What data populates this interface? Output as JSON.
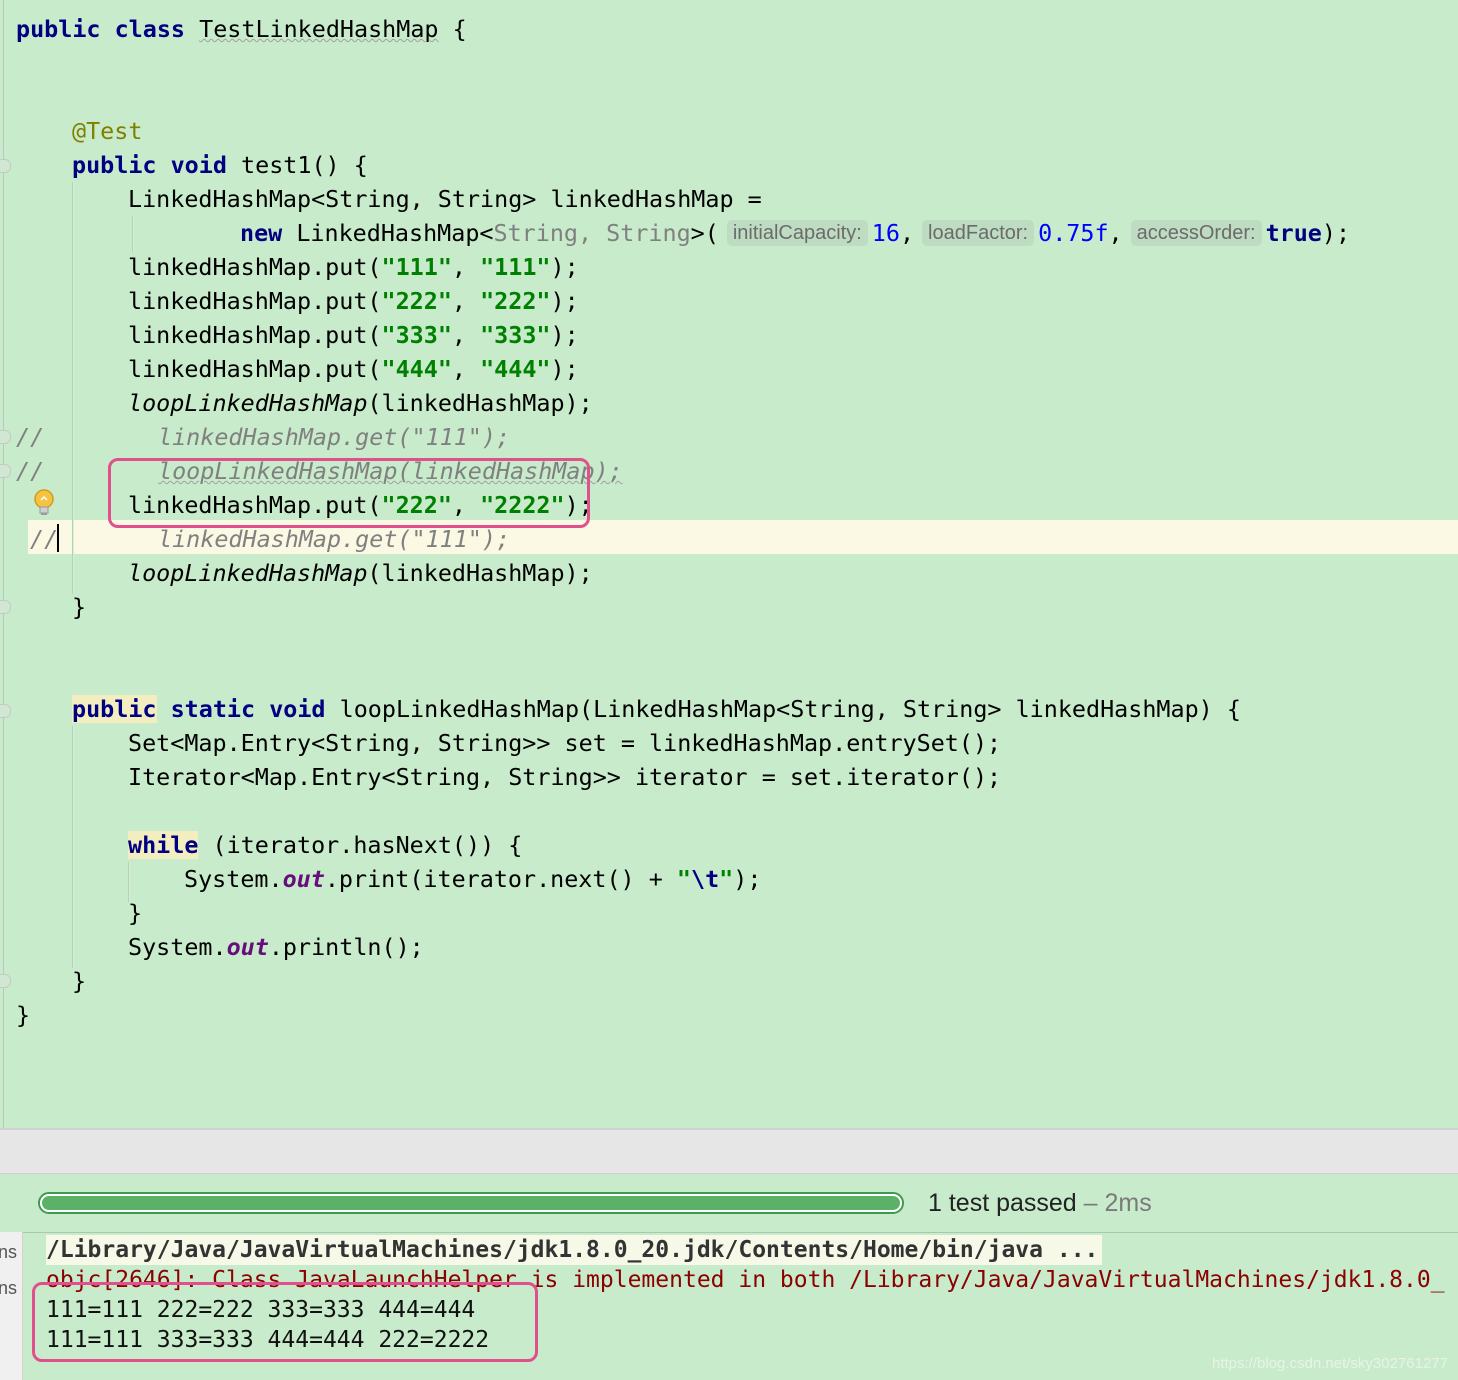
{
  "editor": {
    "class_decl": {
      "kw1": "public",
      "kw2": "class",
      "name": "TestLinkedHashMap",
      "brace": "{"
    },
    "annotation": "@Test",
    "test_method": {
      "kw1": "public",
      "kw2": "void",
      "sig": "test1() {"
    },
    "decl_line": "LinkedHashMap<String, String> linkedHashMap =",
    "ctor_line": {
      "kw": "new",
      "type": "LinkedHashMap<",
      "generics": "String, String",
      "open": ">(",
      "hint1": "initialCapacity:",
      "arg1": "16",
      "comma1": ",",
      "hint2": "loadFactor:",
      "arg2": "0.75f",
      "comma2": ",",
      "hint3": "accessOrder:",
      "arg3": "true",
      "close": ");"
    },
    "puts": [
      {
        "pre": "linkedHashMap.put(",
        "k": "\"111\"",
        "sep": ", ",
        "v": "\"111\"",
        "post": ");"
      },
      {
        "pre": "linkedHashMap.put(",
        "k": "\"222\"",
        "sep": ", ",
        "v": "\"222\"",
        "post": ");"
      },
      {
        "pre": "linkedHashMap.put(",
        "k": "\"333\"",
        "sep": ", ",
        "v": "\"333\"",
        "post": ");"
      },
      {
        "pre": "linkedHashMap.put(",
        "k": "\"444\"",
        "sep": ", ",
        "v": "\"444\"",
        "post": ");"
      }
    ],
    "loop_call_1": {
      "fn": "loopLinkedHashMap",
      "args": "(linkedHashMap);"
    },
    "comment_get_1": {
      "prefix": "//",
      "code": "linkedHashMap.get(\"111\");"
    },
    "comment_loop": {
      "prefix": "//",
      "code": "loopLinkedHashMap(linkedHashMap);"
    },
    "put_update": {
      "pre": "linkedHashMap.put(",
      "k": "\"222\"",
      "sep": ", ",
      "v": "\"2222\"",
      "post": ");"
    },
    "comment_get_2": {
      "prefix": "//",
      "code": "linkedHashMap.get(\"111\");"
    },
    "loop_call_2": {
      "fn": "loopLinkedHashMap",
      "args": "(linkedHashMap);"
    },
    "close_method": "}",
    "loop_method": {
      "kw1": "public",
      "kw2": "static",
      "kw3": "void",
      "sig": "loopLinkedHashMap(LinkedHashMap<String, String> linkedHashMap) {"
    },
    "set_line": "Set<Map.Entry<String, String>> set = linkedHashMap.entrySet();",
    "iter_line": "Iterator<Map.Entry<String, String>> iterator = set.iterator();",
    "while_line": {
      "kw": "while",
      "rest": "(iterator.hasNext()) {"
    },
    "print_line": {
      "pre": "System.",
      "field": "out",
      "mid": ".print(iterator.next() + ",
      "str_open": "\"",
      "esc": "\\t",
      "str_close": "\"",
      "post": ");"
    },
    "while_close": "}",
    "println_line": {
      "pre": "System.",
      "field": "out",
      "post": ".println();"
    },
    "close_loop_method": "}",
    "close_class": "}"
  },
  "run_panel": {
    "progress_fraction": 1.0,
    "status": {
      "passed": "1 test passed",
      "sep": "–",
      "duration": "2ms"
    },
    "side_labels": [
      "ns",
      "ns"
    ],
    "console": {
      "cmd": "/Library/Java/JavaVirtualMachines/jdk1.8.0_20.jdk/Contents/Home/bin/java ...",
      "err": "objc[2646]: Class JavaLaunchHelper is implemented in both /Library/Java/JavaVirtualMachines/jdk1.8.0_",
      "out1": "111=111 222=222 333=333 444=444",
      "out2": "111=111 333=333 444=444 222=2222"
    }
  },
  "watermark": "https://blog.csdn.net/sky302761277"
}
